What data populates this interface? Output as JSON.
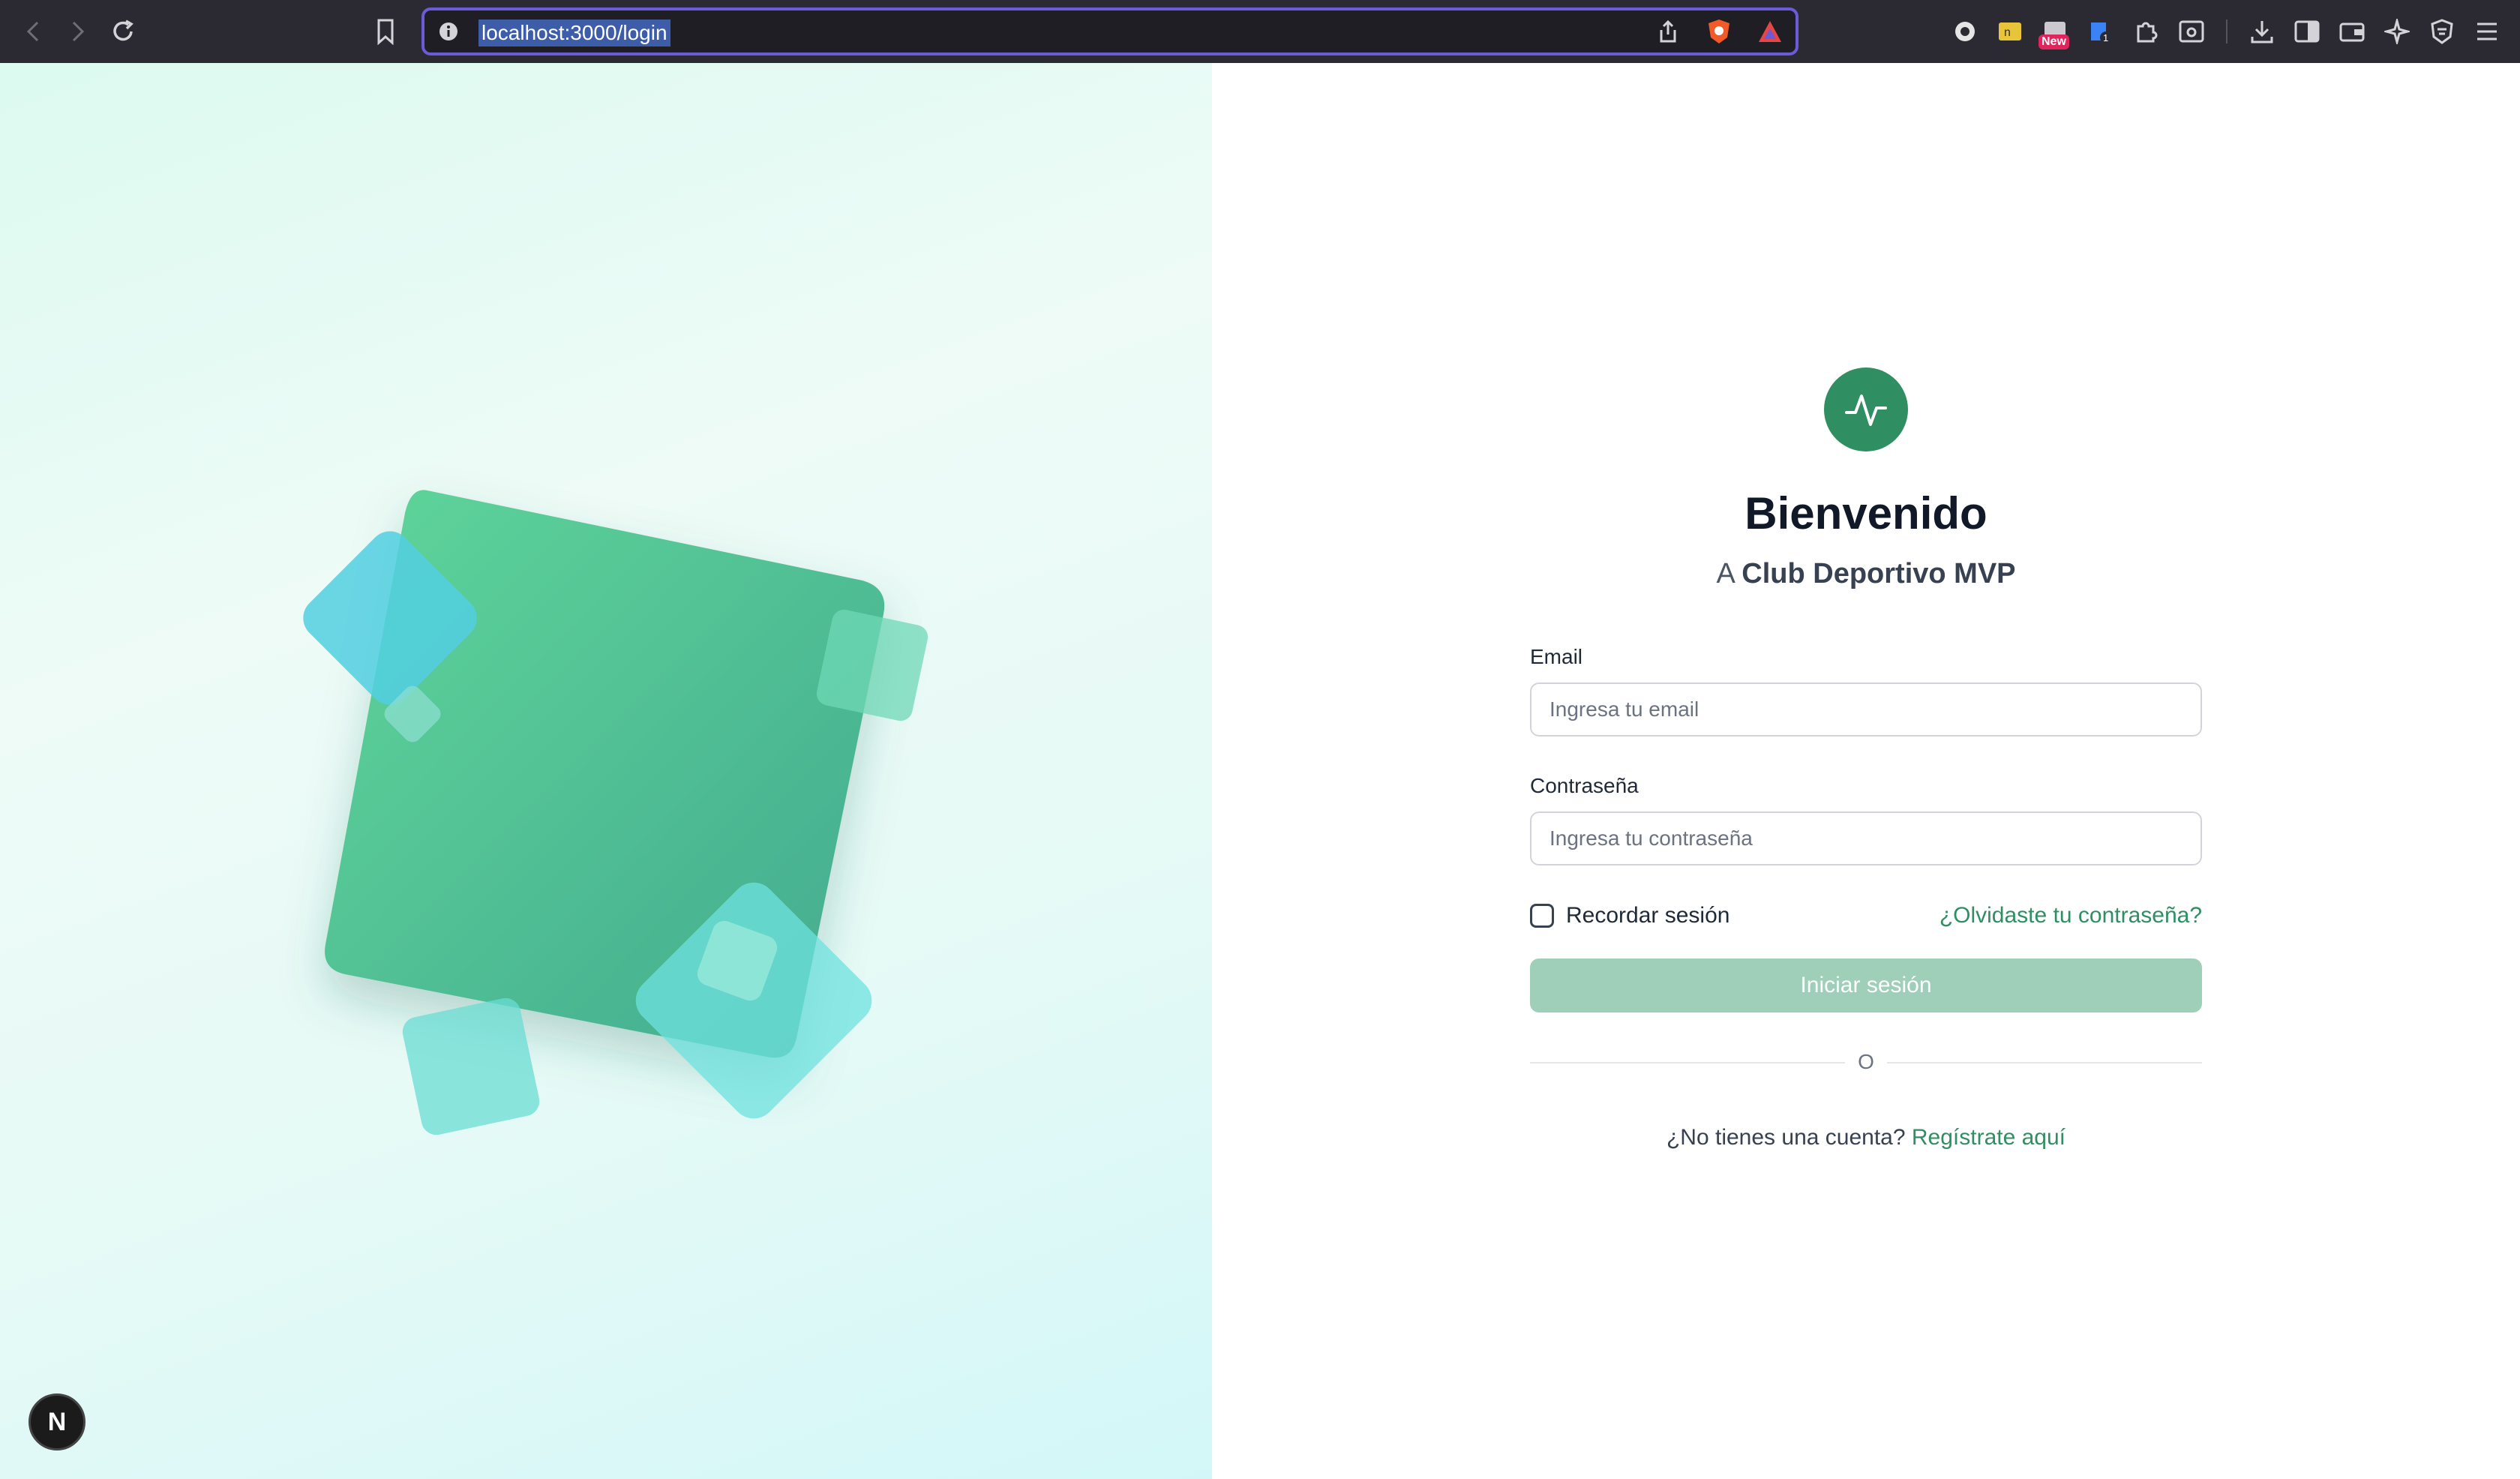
{
  "browser": {
    "url": "localhost:3000/login",
    "extension_badge": "New",
    "icons": [
      "back-icon",
      "forward-icon",
      "reload-icon",
      "bookmark-icon",
      "info-icon",
      "share-icon",
      "brave-shield-icon",
      "brave-rewards-icon",
      "extension-1-icon",
      "extension-2-icon",
      "extension-new-icon",
      "extension-badge-icon",
      "puzzle-icon",
      "screenshot-icon",
      "download-icon",
      "sidebar-icon",
      "wallet-icon",
      "leo-ai-icon",
      "vpn-icon",
      "menu-icon"
    ]
  },
  "colors": {
    "brand": "#2f8f62",
    "button_disabled": "#9fcfb8",
    "url_focus": "#6b5bd6"
  },
  "login": {
    "title": "Bienvenido",
    "subtitle_prefix": "A",
    "subtitle_brand": "Club Deportivo MVP",
    "email_label": "Email",
    "email_placeholder": "Ingresa tu email",
    "password_label": "Contraseña",
    "password_placeholder": "Ingresa tu contraseña",
    "remember_label": "Recordar sesión",
    "forgot_link": "¿Olvidaste tu contraseña?",
    "submit_label": "Iniciar sesión",
    "divider_text": "O",
    "signup_prompt": "¿No tienes una cuenta?",
    "signup_link": "Regístrate aquí"
  },
  "dev": {
    "next_badge": "N"
  }
}
